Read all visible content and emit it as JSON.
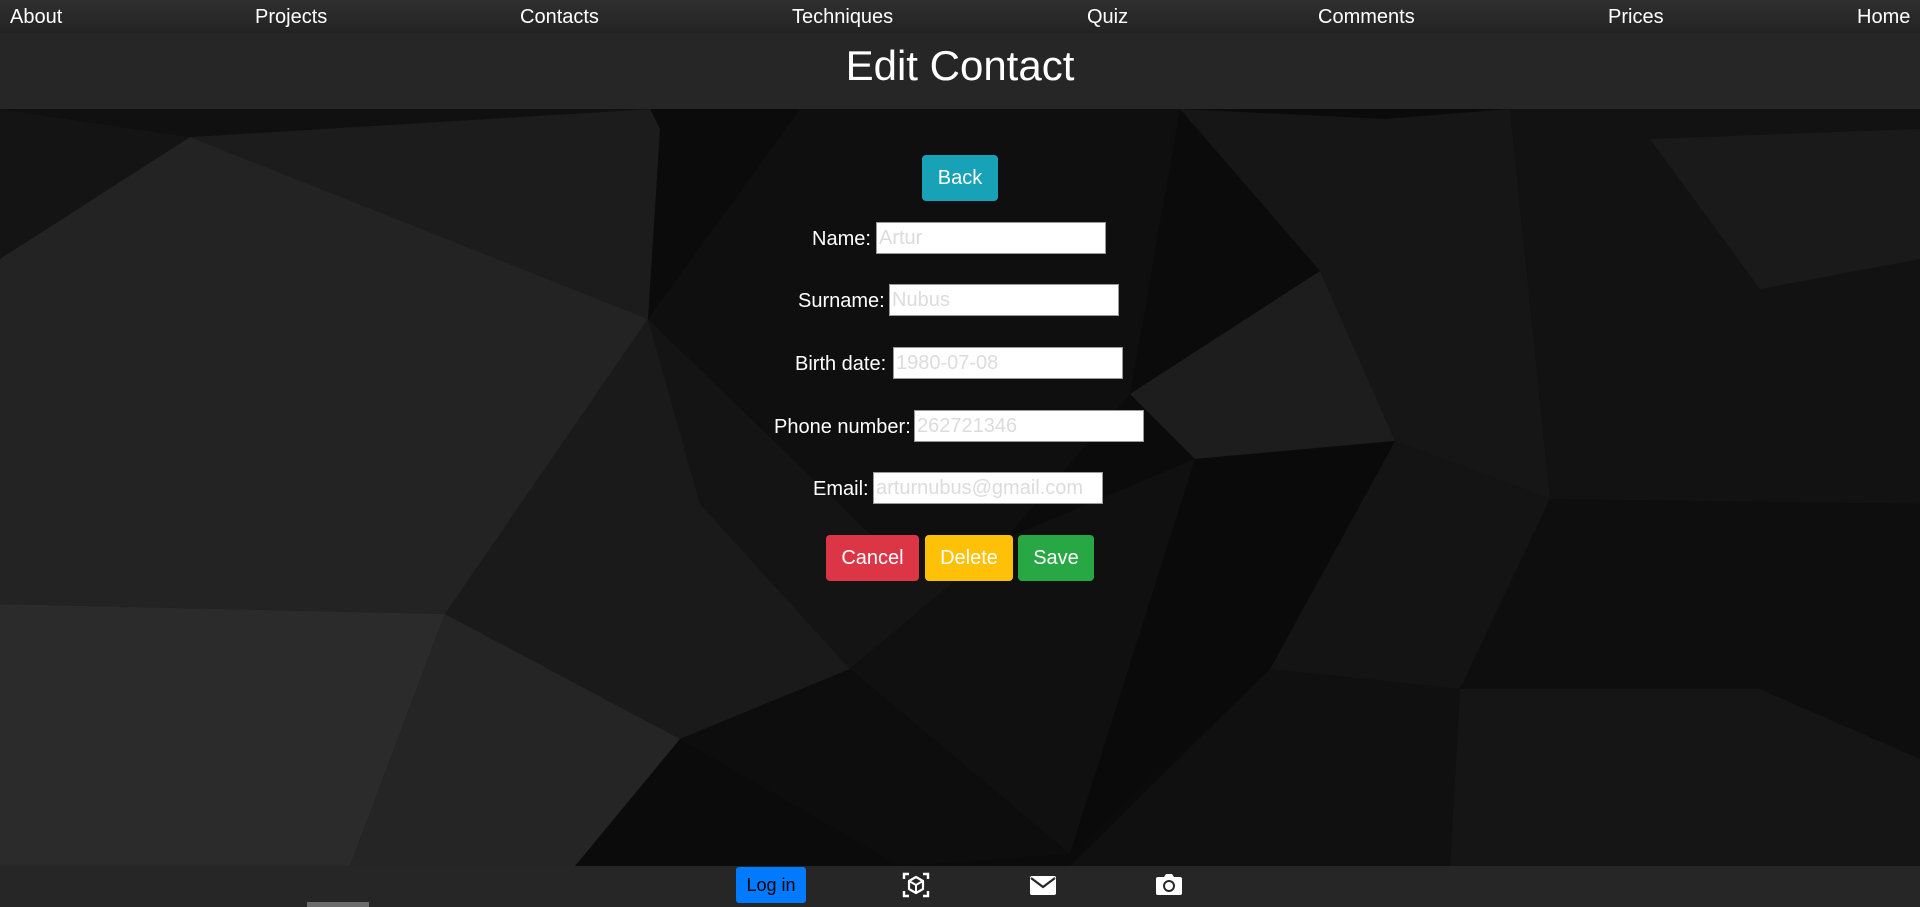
{
  "nav": {
    "items": [
      {
        "label": "About"
      },
      {
        "label": "Projects"
      },
      {
        "label": "Contacts"
      },
      {
        "label": "Techniques"
      },
      {
        "label": "Quiz"
      },
      {
        "label": "Comments"
      },
      {
        "label": "Prices"
      },
      {
        "label": "Home"
      }
    ]
  },
  "header": {
    "title": "Edit Contact"
  },
  "form": {
    "back_label": "Back",
    "fields": [
      {
        "label": "Name:",
        "placeholder": "Artur"
      },
      {
        "label": "Surname:",
        "placeholder": "Nubus"
      },
      {
        "label": "Birth date:",
        "placeholder": "1980-07-08"
      },
      {
        "label": "Phone number:",
        "placeholder": "262721346"
      },
      {
        "label": "Email:",
        "placeholder": "arturnubus@gmail.com"
      }
    ],
    "cancel_label": "Cancel",
    "delete_label": "Delete",
    "save_label": "Save"
  },
  "footer": {
    "login_label": "Log in",
    "icons": [
      "ar-cube-icon",
      "mail-icon",
      "camera-icon"
    ]
  },
  "colors": {
    "back": "#17a2b8",
    "cancel": "#dc3545",
    "delete": "#ffc107",
    "save": "#28a745",
    "login": "#007bff"
  }
}
